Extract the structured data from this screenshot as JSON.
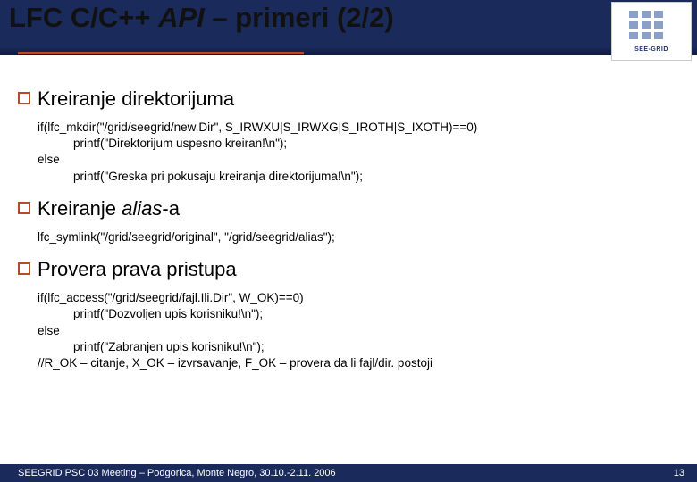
{
  "header": {
    "title_parts": {
      "p1": "LFC C/C++ ",
      "api": "API",
      "p2": " – primeri (2/2)"
    },
    "logo_text": "SEE-GRID"
  },
  "sections": [
    {
      "title": "Kreiranje direktorijuma",
      "code_lines": [
        {
          "t": "if(lfc_mkdir(\"/grid/seegrid/new.Dir\", S_IRWXU|S_IRWXG|S_IROTH|S_IXOTH)==0)"
        },
        {
          "t": "printf(\"Direktorijum uspesno kreiran!\\n\");",
          "indent": true
        },
        {
          "t": "else"
        },
        {
          "t": "printf(\"Greska pri pokusaju kreiranja direktorijuma!\\n\");",
          "indent": true
        }
      ]
    },
    {
      "title_parts": {
        "p1": "Kreiranje ",
        "em": "alias",
        "p2": "-a"
      },
      "code_lines": [
        {
          "t": "lfc_symlink(\"/grid/seegrid/original\", \"/grid/seegrid/alias\");"
        }
      ]
    },
    {
      "title": "Provera prava pristupa",
      "code_lines": [
        {
          "t": "if(lfc_access(\"/grid/seegrid/fajl.Ili.Dir\", W_OK)==0)"
        },
        {
          "t": "printf(\"Dozvoljen upis korisniku!\\n\");",
          "indent": true
        },
        {
          "t": "else"
        },
        {
          "t": "printf(\"Zabranjen upis korisniku!\\n\");",
          "indent": true
        },
        {
          "t": "//R_OK – citanje, X_OK – izvrsavanje, F_OK – provera da li fajl/dir. postoji"
        }
      ]
    }
  ],
  "footer": {
    "left": "SEEGRID PSC 03 Meeting – Podgorica, Monte Negro, 30.10.-2.11. 2006",
    "right": "13"
  }
}
